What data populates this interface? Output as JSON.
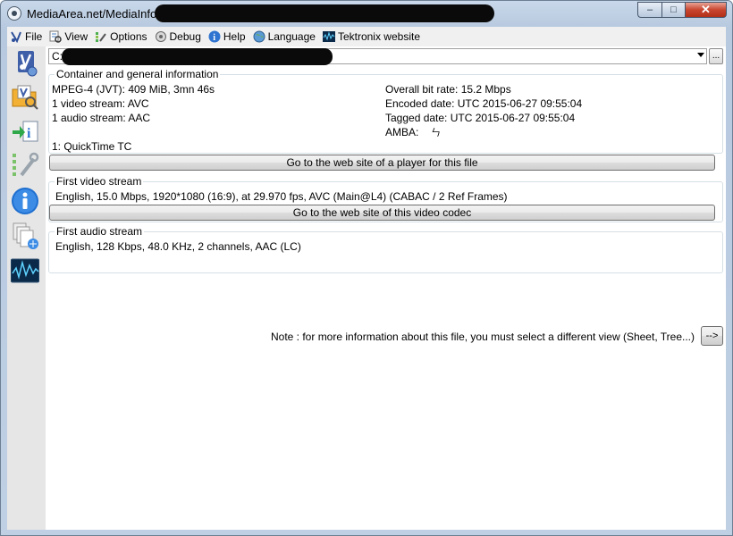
{
  "window": {
    "title": "MediaArea.net/MediaInfo -",
    "controls": {
      "minimize": "–",
      "maximize": "□",
      "close": "✕"
    }
  },
  "menu": [
    {
      "label": "File",
      "icon": "file-icon"
    },
    {
      "label": "View",
      "icon": "view-icon"
    },
    {
      "label": "Options",
      "icon": "options-icon"
    },
    {
      "label": "Debug",
      "icon": "debug-icon"
    },
    {
      "label": "Help",
      "icon": "help-icon"
    },
    {
      "label": "Language",
      "icon": "language-icon"
    },
    {
      "label": "Tektronix website",
      "icon": "tektronix-icon"
    }
  ],
  "sidebar": [
    {
      "icon": "open-file-icon"
    },
    {
      "icon": "open-folder-icon"
    },
    {
      "icon": "export-icon"
    },
    {
      "icon": "preferences-icon"
    },
    {
      "icon": "about-icon"
    },
    {
      "icon": "knowledge-base-icon"
    },
    {
      "icon": "tektronix-waveform-icon"
    }
  ],
  "file_selector": {
    "value": "C:",
    "browse_label": "..."
  },
  "general": {
    "title": "Container and general information",
    "left": [
      "MPEG-4 (JVT): 409 MiB, 3mn 46s",
      "1 video stream: AVC",
      "1 audio stream: AAC"
    ],
    "right": [
      "Overall bit rate: 15.2 Mbps",
      "Encoded date: UTC 2015-06-27 09:55:04",
      "Tagged date: UTC 2015-06-27 09:55:04"
    ],
    "amba_label": "AMBA:",
    "amba_value": "ㄣ",
    "other": "1: QuickTime TC",
    "button": "Go to the web site of a player for this file"
  },
  "video": {
    "title": "First video stream",
    "info": "English, 15.0 Mbps, 1920*1080 (16:9), at 29.970 fps, AVC (Main@L4) (CABAC / 2 Ref Frames)",
    "button": "Go to the web site of this video codec"
  },
  "audio": {
    "title": "First audio stream",
    "info": "English, 128 Kbps, 48.0 KHz, 2 channels, AAC (LC)"
  },
  "note": {
    "text": "Note : for more information about this file, you must select a different view (Sheet, Tree...)",
    "button": "-->"
  }
}
